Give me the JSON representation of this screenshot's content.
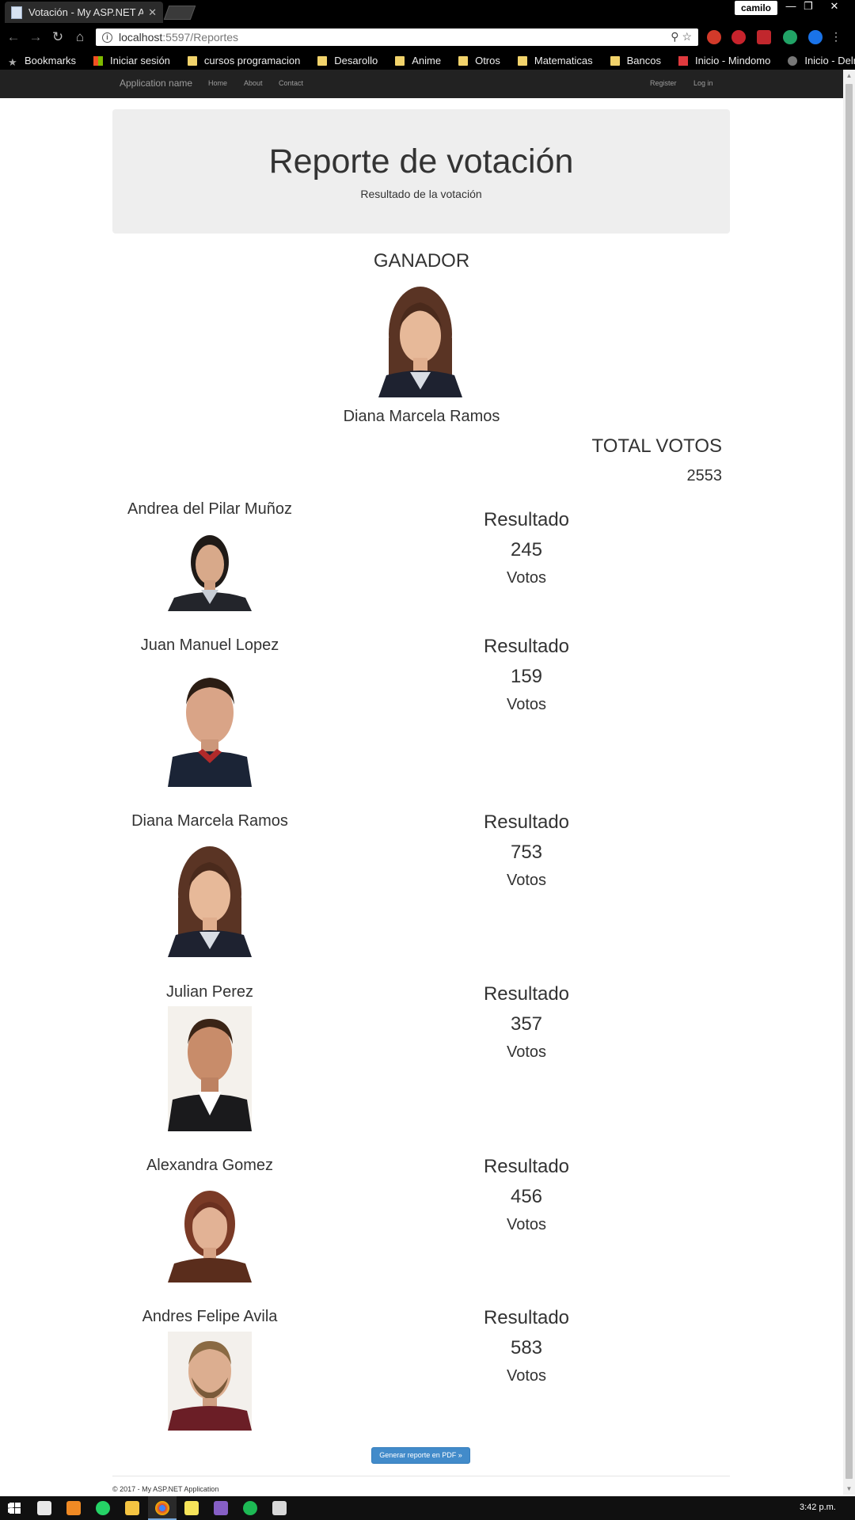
{
  "browser": {
    "tab_title": "Votación - My ASP.NET A",
    "profile": "camilo",
    "url_host": "localhost",
    "url_rest": ":5597/Reportes",
    "bookmarks": [
      "Bookmarks",
      "Iniciar sesión",
      "cursos programacion",
      "Desarollo",
      "Anime",
      "Otros",
      "Matematicas",
      "Bancos",
      "Inicio - Mindomo",
      "Inicio - Delrey Vaping"
    ]
  },
  "navbar": {
    "brand": "Application name",
    "links": [
      "Home",
      "About",
      "Contact"
    ],
    "right_links": [
      "Register",
      "Log in"
    ]
  },
  "jumbotron": {
    "title": "Reporte de votación",
    "subtitle": "Resultado de la votación"
  },
  "winner": {
    "heading": "GANADOR",
    "name": "Diana Marcela Ramos"
  },
  "total": {
    "heading": "TOTAL VOTOS",
    "value": "2553"
  },
  "candidates": [
    {
      "name": "Andrea del Pilar Muñoz",
      "result_label": "Resultado",
      "votes": "245",
      "votes_label": "Votos"
    },
    {
      "name": "Juan Manuel Lopez",
      "result_label": "Resultado",
      "votes": "159",
      "votes_label": "Votos"
    },
    {
      "name": "Diana Marcela Ramos",
      "result_label": "Resultado",
      "votes": "753",
      "votes_label": "Votos"
    },
    {
      "name": "Julian Perez",
      "result_label": "Resultado",
      "votes": "357",
      "votes_label": "Votos"
    },
    {
      "name": "Alexandra Gomez",
      "result_label": "Resultado",
      "votes": "456",
      "votes_label": "Votos"
    },
    {
      "name": "Andres Felipe Avila",
      "result_label": "Resultado",
      "votes": "583",
      "votes_label": "Votos"
    }
  ],
  "pdf_button": "Generar reporte en PDF »",
  "footer": "© 2017 - My ASP.NET Application",
  "taskbar": {
    "clock": "3:42 p.m."
  },
  "colors": {
    "navbar_bg": "#222222",
    "jumbotron_bg": "#eeeeee",
    "button_primary": "#428bca"
  }
}
